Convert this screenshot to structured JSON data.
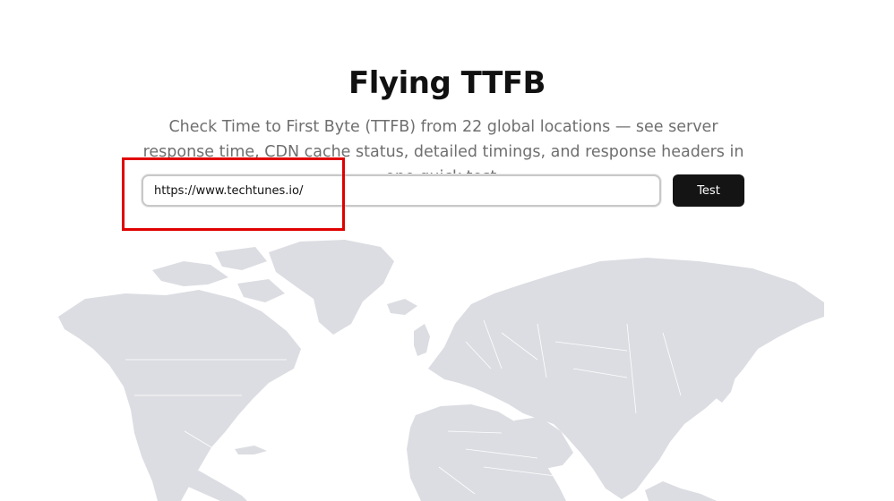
{
  "header": {
    "title": "Flying TTFB",
    "subtitle": "Check Time to First Byte (TTFB) from 22 global locations — see server response time, CDN cache status, detailed timings, and response headers in one quick test."
  },
  "form": {
    "url_value": "https://www.techtunes.io/",
    "test_label": "Test"
  },
  "colors": {
    "accent_button": "#141414",
    "highlight": "#e00000",
    "map_land": "#dcdde2"
  },
  "icons": [
    "world-map"
  ]
}
